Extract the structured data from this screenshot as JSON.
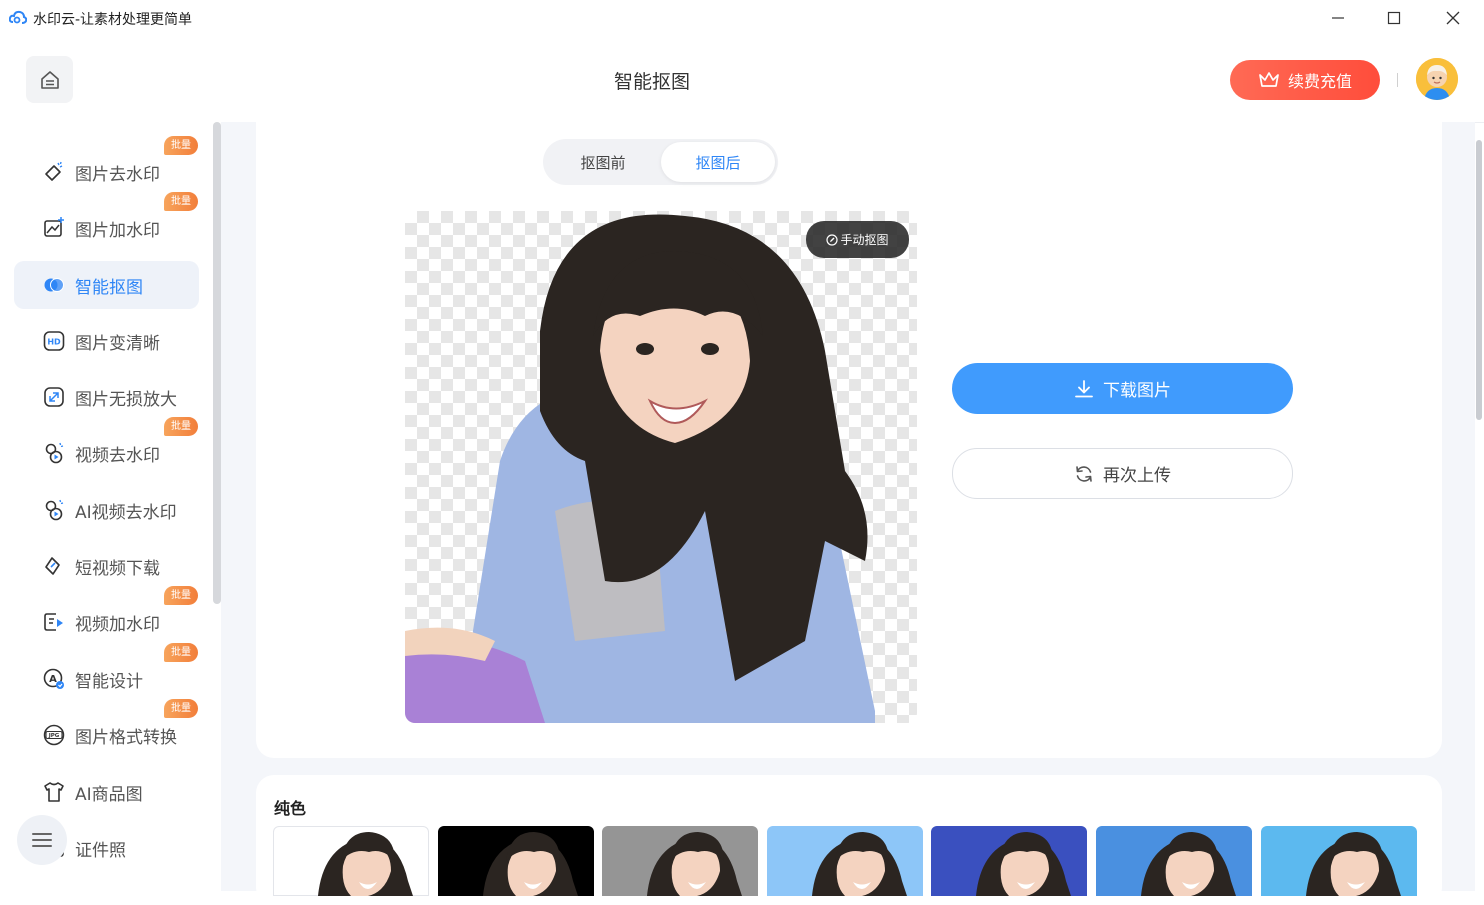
{
  "window": {
    "title": "水印云-让素材处理更简单"
  },
  "header": {
    "title": "智能抠图",
    "renew_label": "续费充值"
  },
  "sidebar": {
    "items": [
      {
        "label": "图片去水印",
        "badge": "批量",
        "icon": "eraser-icon"
      },
      {
        "label": "图片加水印",
        "badge": "批量",
        "icon": "image-add-icon"
      },
      {
        "label": "智能抠图",
        "badge": "",
        "icon": "cutout-icon",
        "active": true
      },
      {
        "label": "图片变清晰",
        "badge": "",
        "icon": "hd-icon"
      },
      {
        "label": "图片无损放大",
        "badge": "",
        "icon": "enlarge-icon"
      },
      {
        "label": "视频去水印",
        "badge": "批量",
        "icon": "video-eraser-icon"
      },
      {
        "label": "AI视频去水印",
        "badge": "",
        "icon": "ai-video-icon"
      },
      {
        "label": "短视频下载",
        "badge": "",
        "icon": "link-icon"
      },
      {
        "label": "视频加水印",
        "badge": "批量",
        "icon": "video-add-icon"
      },
      {
        "label": "智能设计",
        "badge": "批量",
        "icon": "design-icon"
      },
      {
        "label": "图片格式转换",
        "badge": "批量",
        "icon": "jpg-icon"
      },
      {
        "label": "AI商品图",
        "badge": "",
        "icon": "shirt-icon"
      },
      {
        "label": "证件照",
        "badge": "",
        "icon": "id-photo-icon"
      }
    ]
  },
  "main": {
    "tabs": [
      {
        "label": "抠图前"
      },
      {
        "label": "抠图后",
        "active": true
      }
    ],
    "manual_label": "手动抠图",
    "download_label": "下载图片",
    "reupload_label": "再次上传",
    "solid_section_title": "纯色",
    "swatches": [
      "#ffffff",
      "#000000",
      "#959595",
      "#8dc6f8",
      "#3a50bf",
      "#4a90e0",
      "#5cb9ef"
    ]
  },
  "colors": {
    "accent": "#2f86f6",
    "download": "#409bfd",
    "renew": "#ff5a45",
    "badge": "#f2873f"
  }
}
